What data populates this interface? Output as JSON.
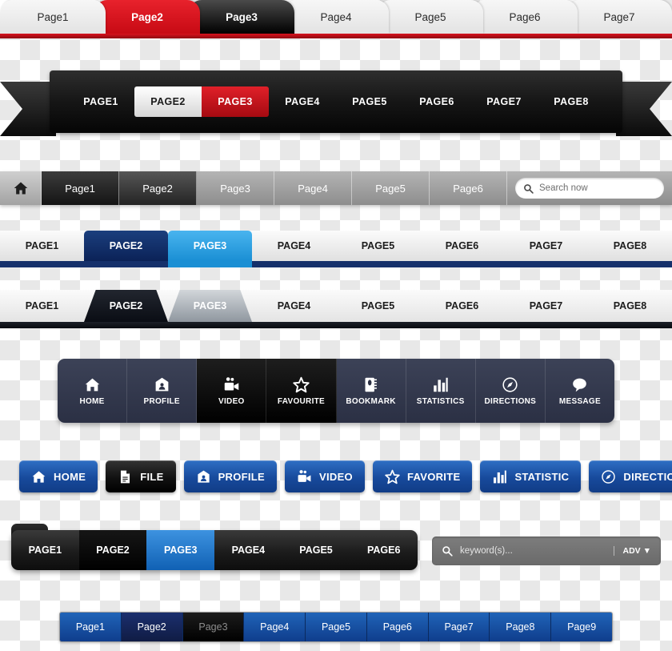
{
  "red_tab_bar": {
    "tabs": [
      {
        "label": "Page1",
        "state": "light"
      },
      {
        "label": "Page2",
        "state": "red"
      },
      {
        "label": "Page3",
        "state": "black"
      },
      {
        "label": "Page4",
        "state": "light"
      },
      {
        "label": "Page5",
        "state": "light"
      },
      {
        "label": "Page6",
        "state": "light"
      },
      {
        "label": "Page7",
        "state": "light"
      }
    ],
    "accent_color": "#c70a14"
  },
  "black_ribbon": {
    "items": [
      {
        "label": "PAGE1",
        "state": "default"
      },
      {
        "label": "PAGE2",
        "state": "white"
      },
      {
        "label": "PAGE3",
        "state": "red"
      },
      {
        "label": "PAGE4",
        "state": "default"
      },
      {
        "label": "PAGE5",
        "state": "default"
      },
      {
        "label": "PAGE6",
        "state": "default"
      },
      {
        "label": "PAGE7",
        "state": "default"
      },
      {
        "label": "PAGE8",
        "state": "default"
      }
    ],
    "accent_color": "#a50a11"
  },
  "gray_bar": {
    "home_icon": "home-icon",
    "items": [
      {
        "label": "Page1",
        "state": "dark"
      },
      {
        "label": "Page2",
        "state": "dark2"
      },
      {
        "label": "Page3",
        "state": "default"
      },
      {
        "label": "Page4",
        "state": "default"
      },
      {
        "label": "Page5",
        "state": "default"
      },
      {
        "label": "Page6",
        "state": "default"
      }
    ],
    "search": {
      "placeholder": "Search now",
      "icon": "search-icon"
    }
  },
  "blue_tab_bar": {
    "tabs": [
      {
        "label": "PAGE1",
        "state": "light"
      },
      {
        "label": "PAGE2",
        "state": "navy"
      },
      {
        "label": "PAGE3",
        "state": "sky"
      },
      {
        "label": "PAGE4",
        "state": "light"
      },
      {
        "label": "PAGE5",
        "state": "light"
      },
      {
        "label": "PAGE6",
        "state": "light"
      },
      {
        "label": "PAGE7",
        "state": "light"
      },
      {
        "label": "PAGE8",
        "state": "light"
      }
    ],
    "navy_color": "#0b2257",
    "sky_color": "#1a8fd4"
  },
  "dark_tab_bar": {
    "tabs": [
      {
        "label": "PAGE1",
        "state": "light"
      },
      {
        "label": "PAGE2",
        "state": "dark"
      },
      {
        "label": "PAGE3",
        "state": "gray"
      },
      {
        "label": "PAGE4",
        "state": "light"
      },
      {
        "label": "PAGE5",
        "state": "light"
      },
      {
        "label": "PAGE6",
        "state": "light"
      },
      {
        "label": "PAGE7",
        "state": "light"
      },
      {
        "label": "PAGE8",
        "state": "light"
      }
    ]
  },
  "icon_nav": {
    "items": [
      {
        "label": "HOME",
        "icon": "home-icon",
        "state": "default"
      },
      {
        "label": "PROFILE",
        "icon": "profile-icon",
        "state": "default"
      },
      {
        "label": "VIDEO",
        "icon": "video-camera-icon",
        "state": "active"
      },
      {
        "label": "FAVOURITE",
        "icon": "star-icon",
        "state": "active"
      },
      {
        "label": "BOOKMARK",
        "icon": "notebook-icon",
        "state": "default"
      },
      {
        "label": "STATISTICS",
        "icon": "bar-chart-icon",
        "state": "default"
      },
      {
        "label": "DIRECTIONS",
        "icon": "compass-icon",
        "state": "default"
      },
      {
        "label": "MESSAGE",
        "icon": "speech-bubble-icon",
        "state": "default"
      }
    ]
  },
  "button_row": {
    "buttons": [
      {
        "label": "HOME",
        "icon": "home-icon",
        "state": "blue"
      },
      {
        "label": "FILE",
        "icon": "document-icon",
        "state": "black"
      },
      {
        "label": "PROFILE",
        "icon": "profile-icon",
        "state": "blue"
      },
      {
        "label": "VIDEO",
        "icon": "video-camera-icon",
        "state": "blue"
      },
      {
        "label": "FAVORITE",
        "icon": "star-icon",
        "state": "blue"
      },
      {
        "label": "STATISTIC",
        "icon": "bar-chart-icon",
        "state": "blue"
      },
      {
        "label": "DIRECTION",
        "icon": "compass-icon",
        "state": "blue"
      }
    ],
    "blue_color": "#174a9c"
  },
  "rounded_bar": {
    "pages": [
      {
        "label": "PAGE1",
        "state": "default"
      },
      {
        "label": "PAGE2",
        "state": "black"
      },
      {
        "label": "PAGE3",
        "state": "blue"
      },
      {
        "label": "PAGE4",
        "state": "default"
      },
      {
        "label": "PAGE5",
        "state": "default"
      },
      {
        "label": "PAGE6",
        "state": "default"
      }
    ],
    "search": {
      "placeholder": "keyword(s)...",
      "icon": "search-icon",
      "adv_label": "ADV ▼"
    },
    "active_color": "#1061b4"
  },
  "pagination": {
    "pages": [
      {
        "label": "Page1",
        "state": "default"
      },
      {
        "label": "Page2",
        "state": "navy"
      },
      {
        "label": "Page3",
        "state": "disabled"
      },
      {
        "label": "Page4",
        "state": "default"
      },
      {
        "label": "Page5",
        "state": "default"
      },
      {
        "label": "Page6",
        "state": "default"
      },
      {
        "label": "Page7",
        "state": "default"
      },
      {
        "label": "Page8",
        "state": "default"
      },
      {
        "label": "Page9",
        "state": "default"
      }
    ],
    "base_color": "#0f3d8c"
  }
}
